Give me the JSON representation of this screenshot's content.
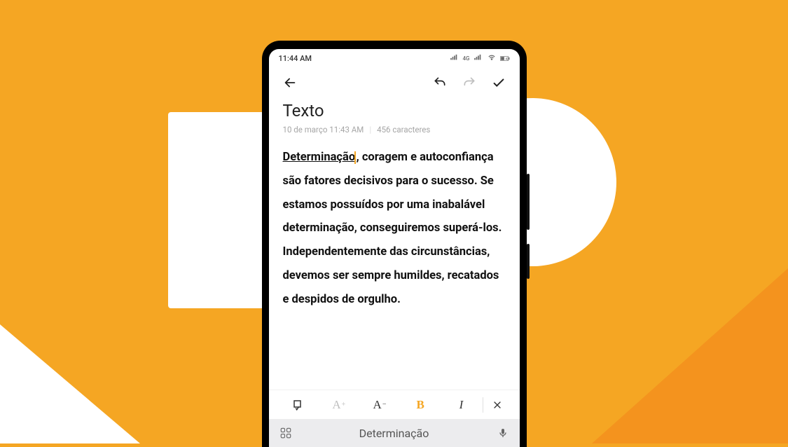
{
  "status": {
    "time": "11:44 AM",
    "network": "4G",
    "battery": "42"
  },
  "header": {
    "back": "←",
    "undo": "↶",
    "redo": "↷",
    "confirm": "✓"
  },
  "note": {
    "title": "Texto",
    "meta_date": "10 de março  11:43 AM",
    "meta_chars": "456 caracteres",
    "body_underlined": "Determinação",
    "body_rest": ", coragem e autoconfiança são fatores decisivos para o sucesso. Se estamos possuídos por uma inabalável determinação, conseguiremos superá-los. Independentemente das circunstâncias, devemos ser sempre humildes, recatados e despidos de orgulho."
  },
  "format": {
    "checklist": "✓",
    "inc_label": "A",
    "inc_sup": "+",
    "dec_label": "A",
    "dec_sup": "−",
    "bold": "B",
    "italic": "I",
    "close": "✕"
  },
  "keyboard": {
    "suggestion": "Determinação"
  },
  "colors": {
    "accent": "#f5a623"
  }
}
